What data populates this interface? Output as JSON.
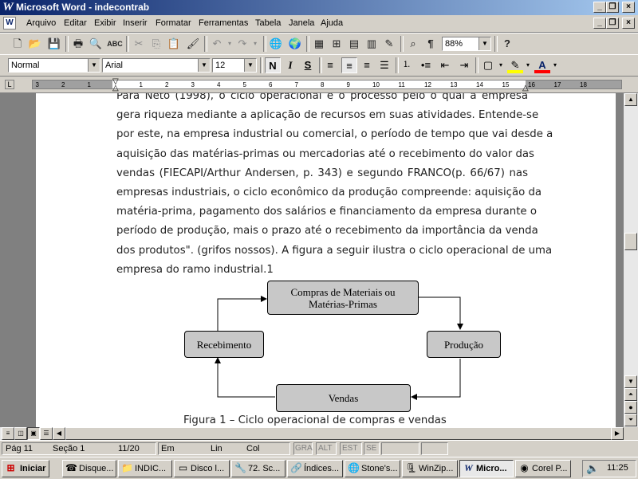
{
  "window": {
    "title": "Microsoft Word - indecontrab"
  },
  "menu": [
    "Arquivo",
    "Editar",
    "Exibir",
    "Inserir",
    "Formatar",
    "Ferramentas",
    "Tabela",
    "Janela",
    "Ajuda"
  ],
  "toolbar": {
    "zoom": "88%"
  },
  "format": {
    "style": "Normal",
    "font": "Arial",
    "size": "12",
    "bold": "N",
    "italic": "I",
    "underline": "S"
  },
  "ruler": {
    "ticks": [
      "3",
      "2",
      "1",
      "1",
      "2",
      "3",
      "4",
      "5",
      "6",
      "7",
      "8",
      "9",
      "10",
      "11",
      "12",
      "13",
      "14",
      "15",
      "16",
      "17",
      "18"
    ]
  },
  "document": {
    "lines": [
      "Para Neto (1998), o ciclo operacional é o processo pelo o qual a empresa",
      "gera riqueza mediante a aplicação de recursos em suas atividades. Entende-se",
      "por este, na empresa industrial ou comercial, o período de tempo que vai desde a",
      "aquisição das matérias-primas ou mercadorias até o recebimento do valor das",
      "vendas (FIECAPI/Arthur Andersen, p. 343) e segundo FRANCO(p. 66/67) nas",
      "empresas industriais, o ciclo econômico da produção compreende: aquisição da",
      "matéria-prima, pagamento dos salários e financiamento da empresa durante o",
      "período de produção, mais o prazo até o recebimento da importância da venda",
      "dos produtos\". (grifos nossos). A figura a seguir ilustra o ciclo operacional de uma",
      "empresa do ramo industrial.1"
    ],
    "diagram": {
      "top": "Compras de Materiais ou\nMatérias-Primas",
      "right": "Produção",
      "bottom": "Vendas",
      "left": "Recebimento"
    },
    "caption": "Figura 1 – Ciclo operacional de compras e vendas"
  },
  "status": {
    "page": "Pág 11",
    "section": "Seção 1",
    "pages": "11/20",
    "at": "Em",
    "line": "Lin",
    "col": "Col",
    "modes": [
      "GRA",
      "ALT",
      "EST",
      "SE"
    ]
  },
  "taskbar": {
    "start": "Iniciar",
    "buttons": [
      "Disque...",
      "INDIC...",
      "Disco l...",
      "72. Sc...",
      "Índices...",
      "Stone's...",
      "WinZip...",
      "Micro...",
      "Corel P..."
    ],
    "active": "Micro...",
    "clock": "11:25"
  }
}
